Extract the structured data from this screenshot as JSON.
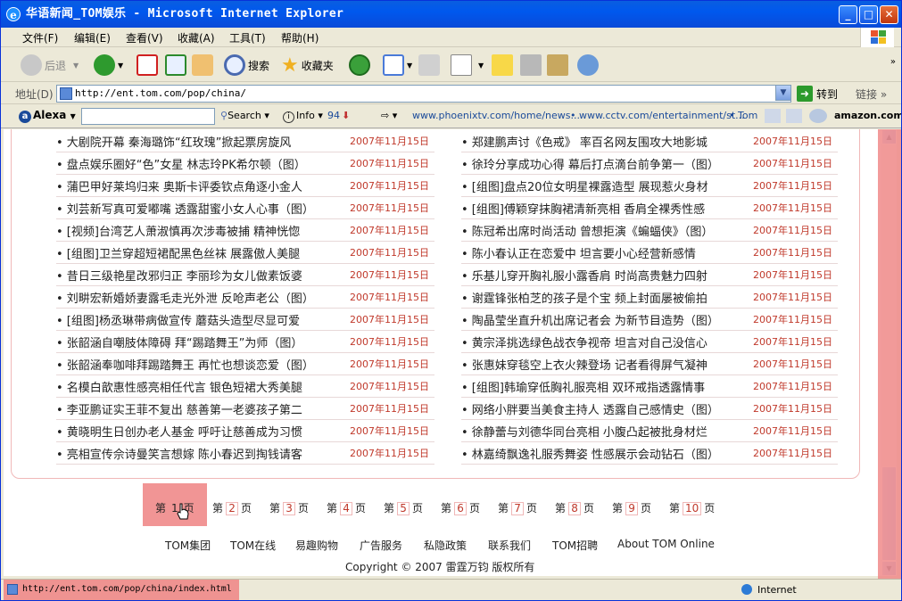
{
  "window": {
    "title": "华语新闻_TOM娱乐 - Microsoft Internet Explorer",
    "minimize": "_",
    "maximize": "□",
    "close": "✕"
  },
  "menu": [
    "文件(F)",
    "编辑(E)",
    "查看(V)",
    "收藏(A)",
    "工具(T)",
    "帮助(H)"
  ],
  "toolbar": {
    "back": "后退",
    "search": "搜索",
    "favorites": "收藏夹"
  },
  "address": {
    "label": "地址(D)",
    "url": "http://ent.tom.com/pop/china/",
    "go": "转到",
    "links": "链接"
  },
  "alexa": {
    "logo": "Alexa",
    "search": "Search",
    "info": "Info",
    "count": "94",
    "link1": "www.phoenixtv.com/home/news...",
    "link2": "www.cctv.com/entertainment/st...",
    "link3": "Tom",
    "amazon": "amazon.com."
  },
  "news_left": [
    {
      "title": "• 大剧院开幕  秦海璐饰“红玫瑰”掀起票房旋风",
      "date": "2007年11月15日"
    },
    {
      "title": "• 盘点娱乐圈好“色”女星  林志玲PK希尔顿（图）",
      "date": "2007年11月15日"
    },
    {
      "title": "• 蒲巴甲好莱坞归来  奥斯卡评委钦点角逐小金人",
      "date": "2007年11月15日"
    },
    {
      "title": "• 刘芸新写真可爱嘟嘴  透露甜蜜小女人心事（图）",
      "date": "2007年11月15日"
    },
    {
      "title": "• [视频]台湾艺人萧淑慎再次涉毒被捕  精神恍惚",
      "date": "2007年11月15日"
    },
    {
      "title": "• [组图]卫兰穿超短裙配黑色丝袜  展露傲人美腿",
      "date": "2007年11月15日"
    },
    {
      "title": "• 昔日三级艳星改邪归正  李丽珍为女儿做素饭婆",
      "date": "2007年11月15日"
    },
    {
      "title": "• 刘畊宏新婚娇妻露毛走光外泄  反呛声老公（图）",
      "date": "2007年11月15日"
    },
    {
      "title": "• [组图]杨丞琳带病做宣传  蘑菇头造型尽显可爱",
      "date": "2007年11月15日"
    },
    {
      "title": "• 张韶涵自嘲肢体障碍  拜“踢踏舞王”为师（图）",
      "date": "2007年11月15日"
    },
    {
      "title": "• 张韶涵奉咖啡拜踢踏舞王  再忙也想谈恋爱（图）",
      "date": "2007年11月15日"
    },
    {
      "title": "• 名模白歆惠性感亮相任代言  银色短裙大秀美腿",
      "date": "2007年11月15日"
    },
    {
      "title": "• 李亚鹏证实王菲不复出  慈善第一老婆孩子第二",
      "date": "2007年11月15日"
    },
    {
      "title": "• 黄晓明生日创办老人基金  呼吁让慈善成为习惯",
      "date": "2007年11月15日"
    },
    {
      "title": "• 亮相宣传佘诗曼笑言想嫁  陈小春迟到掏钱请客",
      "date": "2007年11月15日"
    }
  ],
  "news_right": [
    {
      "title": "• 郑建鹏声讨《色戒》  率百名网友围攻大地影城",
      "date": "2007年11月15日"
    },
    {
      "title": "• 徐玲分享成功心得  幕后打点滴台前争第一（图）",
      "date": "2007年11月15日"
    },
    {
      "title": "• [组图]盘点20位女明星裸露造型  展现惹火身材",
      "date": "2007年11月15日"
    },
    {
      "title": "• [组图]傅颖穿抹胸裙清新亮相  香肩全裸秀性感",
      "date": "2007年11月15日"
    },
    {
      "title": "• 陈冠希出席时尚活动  曾想拒演《蝙蝠侠》（图）",
      "date": "2007年11月15日"
    },
    {
      "title": "• 陈小春认正在恋爱中  坦言要小心经营新感情",
      "date": "2007年11月15日"
    },
    {
      "title": "• 乐基儿穿开胸礼服小露香肩  时尚高贵魅力四射",
      "date": "2007年11月15日"
    },
    {
      "title": "• 谢霆锋张柏芝的孩子是个宝  频上封面屡被偷拍",
      "date": "2007年11月15日"
    },
    {
      "title": "• 陶晶莹坐直升机出席记者会  为新节目造势（图）",
      "date": "2007年11月15日"
    },
    {
      "title": "• 黄宗泽挑选绿色战衣争视帝  坦言对自己没信心",
      "date": "2007年11月15日"
    },
    {
      "title": "• 张惠妹穿毯空上衣火辣登场  记者看得屏气凝神",
      "date": "2007年11月15日"
    },
    {
      "title": "• [组图]韩瑜穿低胸礼服亮相  双环戒指透露情事",
      "date": "2007年11月15日"
    },
    {
      "title": "• 网络小胖要当美食主持人  透露自己感情史（图）",
      "date": "2007年11月15日"
    },
    {
      "title": "• 徐静蕾与刘德华同台亮相  小腹凸起被批身材烂",
      "date": "2007年11月15日"
    },
    {
      "title": "• 林嘉绮飘逸礼服秀舞姿  性感展示会动钻石（图）",
      "date": "2007年11月15日"
    }
  ],
  "pager": {
    "prefix": "第",
    "suffix": "页",
    "pages": [
      "1",
      "2",
      "3",
      "4",
      "5",
      "6",
      "7",
      "8",
      "9",
      "10"
    ]
  },
  "footer": {
    "links": [
      "TOM集团",
      "TOM在线",
      "易趣购物",
      "广告服务",
      "私隐政策",
      "联系我们",
      "TOM招聘",
      "About TOM Online"
    ],
    "copyright": "Copyright © 2007  雷霆万钧  版权所有"
  },
  "status": {
    "url": "http://ent.tom.com/pop/china/index.html",
    "zone": "Internet"
  },
  "colors": {
    "accent": "#c0392b",
    "highlight": "#f08a8a",
    "border": "#f0b8b8"
  }
}
